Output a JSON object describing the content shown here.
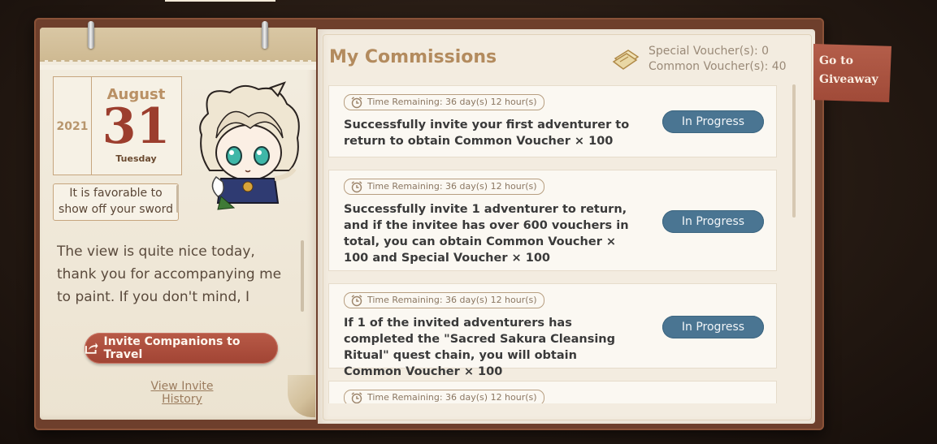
{
  "calendar": {
    "year": "2021",
    "month": "August",
    "day": "31",
    "weekday": "Tuesday",
    "fortune": "It is favorable to show off your sword skill"
  },
  "character_quote": "The view is quite nice today, thank you for accompanying me to paint. If you don't mind, I",
  "invite_button": {
    "label": "Invite Companions to Travel",
    "icon": "share-icon"
  },
  "history_link": "View Invite History",
  "commissions": {
    "title": "My Commissions",
    "special_vouchers": "Special Voucher(s): 0",
    "common_vouchers": "Common Voucher(s): 40",
    "items": [
      {
        "time": "Time Remaining: 36 day(s) 12 hour(s)",
        "text": "Successfully invite your first adventurer to return to obtain Common Voucher × 100",
        "status": "In Progress"
      },
      {
        "time": "Time Remaining: 36 day(s) 12 hour(s)",
        "text": "Successfully invite 1 adventurer to return, and if the invitee has over 600 vouchers in total, you can obtain Common Voucher × 100 and Special Voucher × 100",
        "status": "In Progress"
      },
      {
        "time": "Time Remaining: 36 day(s) 12 hour(s)",
        "text": "If 1 of the invited adventurers has completed the \"Sacred Sakura Cleansing Ritual\" quest chain, you will obtain Common Voucher × 100",
        "status": "In Progress"
      },
      {
        "time": "Time Remaining: 36 day(s) 12 hour(s)"
      }
    ]
  },
  "giveaway_tab": "Go to Giveaway",
  "colors": {
    "accent_red": "#a84b3a",
    "status_blue": "#4a7592",
    "title_gold": "#b38b5e"
  }
}
